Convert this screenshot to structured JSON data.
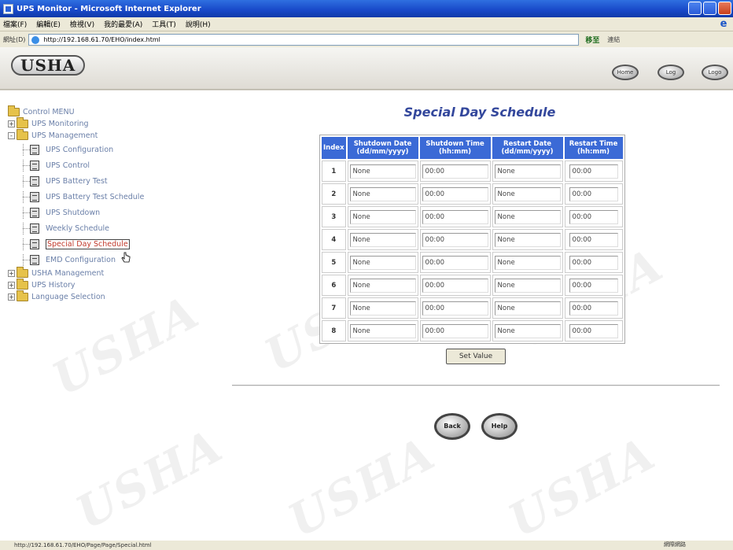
{
  "window": {
    "title": "UPS Monitor - Microsoft Internet Explorer"
  },
  "menubar": {
    "items": [
      "檔案(F)",
      "編輯(E)",
      "檢視(V)",
      "我的最愛(A)",
      "工具(T)",
      "說明(H)"
    ]
  },
  "address": {
    "label": "網址(D)",
    "url": "http://192.168.61.70/EHO/index.html",
    "go_label": "移至",
    "links_label": "連結"
  },
  "header": {
    "logo": "USHA",
    "buttons": [
      "Home",
      "Log",
      "Logo"
    ]
  },
  "tree": {
    "root": "Control MENU",
    "items": [
      {
        "label": "UPS Monitoring",
        "type": "folder",
        "expand": "+"
      },
      {
        "label": "UPS Management",
        "type": "folder",
        "expand": "-"
      },
      {
        "label": "UPS Configuration",
        "type": "doc"
      },
      {
        "label": "UPS Control",
        "type": "doc"
      },
      {
        "label": "UPS Battery Test",
        "type": "doc"
      },
      {
        "label": "UPS Battery Test Schedule",
        "type": "doc"
      },
      {
        "label": "UPS Shutdown",
        "type": "doc"
      },
      {
        "label": "Weekly Schedule",
        "type": "doc"
      },
      {
        "label": "Special Day Schedule",
        "type": "doc",
        "selected": true
      },
      {
        "label": "EMD Configuration",
        "type": "doc"
      },
      {
        "label": "USHA Management",
        "type": "folder",
        "expand": "+"
      },
      {
        "label": "UPS History",
        "type": "folder",
        "expand": "+"
      },
      {
        "label": "Language Selection",
        "type": "folder",
        "expand": "+"
      }
    ]
  },
  "main": {
    "title": "Special Day Schedule",
    "columns": [
      "Index",
      "Shutdown Date\n(dd/mm/yyyy)",
      "Shutdown Time\n(hh:mm)",
      "Restart Date\n(dd/mm/yyyy)",
      "Restart Time\n(hh:mm)"
    ],
    "rows": [
      {
        "index": "1",
        "shutdown_date": "None",
        "shutdown_time": "00:00",
        "restart_date": "None",
        "restart_time": "00:00"
      },
      {
        "index": "2",
        "shutdown_date": "None",
        "shutdown_time": "00:00",
        "restart_date": "None",
        "restart_time": "00:00"
      },
      {
        "index": "3",
        "shutdown_date": "None",
        "shutdown_time": "00:00",
        "restart_date": "None",
        "restart_time": "00:00"
      },
      {
        "index": "4",
        "shutdown_date": "None",
        "shutdown_time": "00:00",
        "restart_date": "None",
        "restart_time": "00:00"
      },
      {
        "index": "5",
        "shutdown_date": "None",
        "shutdown_time": "00:00",
        "restart_date": "None",
        "restart_time": "00:00"
      },
      {
        "index": "6",
        "shutdown_date": "None",
        "shutdown_time": "00:00",
        "restart_date": "None",
        "restart_time": "00:00"
      },
      {
        "index": "7",
        "shutdown_date": "None",
        "shutdown_time": "00:00",
        "restart_date": "None",
        "restart_time": "00:00"
      },
      {
        "index": "8",
        "shutdown_date": "None",
        "shutdown_time": "00:00",
        "restart_date": "None",
        "restart_time": "00:00"
      }
    ],
    "set_button": "Set Value",
    "back_button": "Back",
    "help_button": "Help"
  },
  "watermark": "USHA",
  "statusbar": {
    "url": "http://192.168.61.70/EHO/Page/Page/Special.html",
    "zone": "網際網路"
  },
  "colors": {
    "table_header": "#3b6ad6",
    "title": "#33479c",
    "titlebar": "#1848c8"
  }
}
